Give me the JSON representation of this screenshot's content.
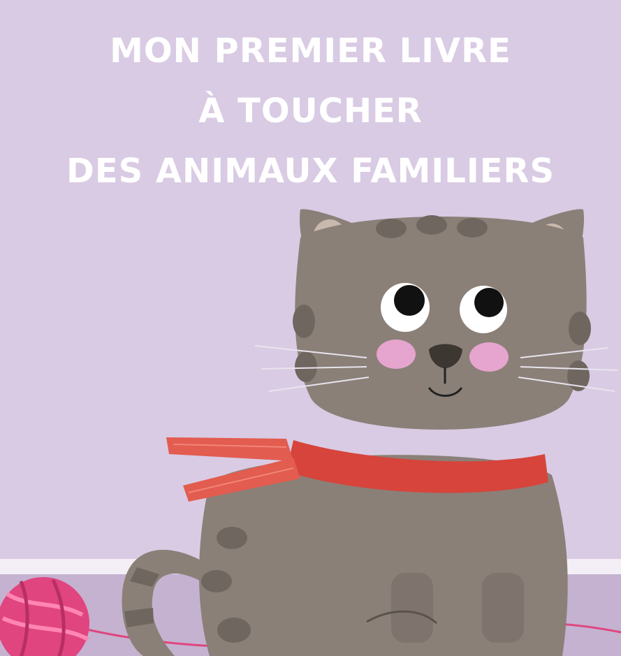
{
  "cover": {
    "title_lines": [
      "MON PREMIER LIVRE",
      "À TOUCHER",
      "DES ANIMAUX FAMILIERS"
    ]
  },
  "colors": {
    "wall": "#d9cbe3",
    "baseboard": "#f4eff6",
    "floor": "#c4b2d0",
    "title_text": "#ffffff",
    "cat_fur": "#8a8078",
    "cat_stripes": "#6f665f",
    "ear_inner": "#c9b8ad",
    "cheeks": "#e6a5cf",
    "scarf": "#d6443c",
    "yarn": "#e0457f"
  },
  "illustration": {
    "subject": "cat-with-scarf",
    "props": [
      "yarn-ball"
    ]
  }
}
